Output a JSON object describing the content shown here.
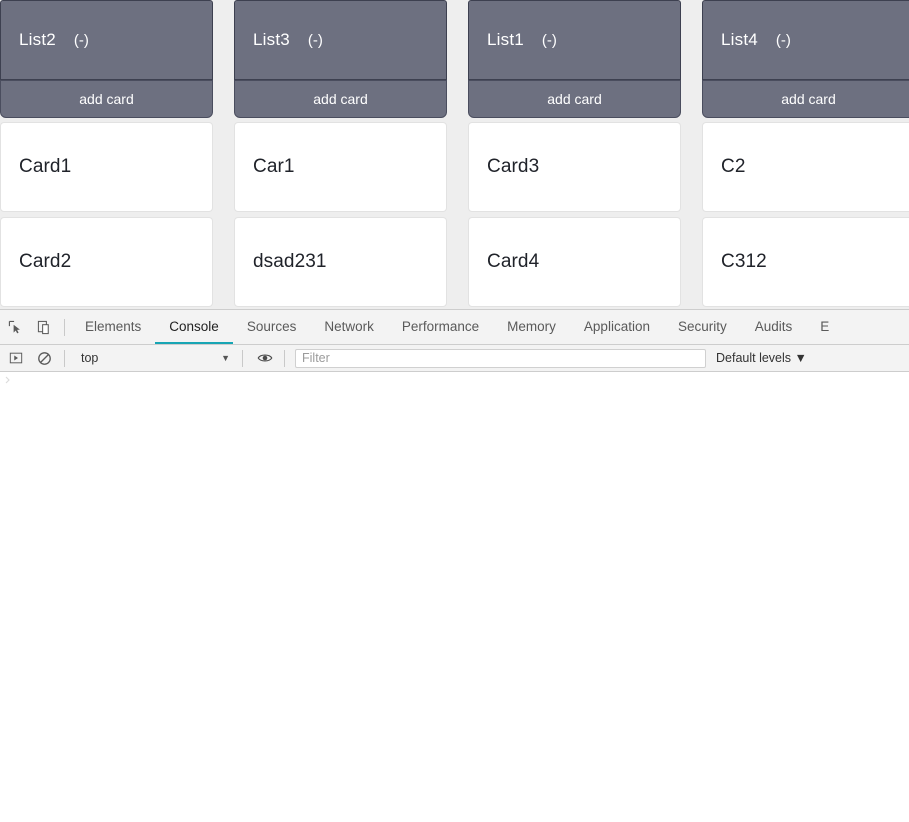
{
  "board": {
    "background_color": "#eeeeee",
    "list_header_color": "#6d7080",
    "lists": [
      {
        "title": "List2",
        "collapse_label": "(-)",
        "add_card_label": "add card",
        "cards": [
          {
            "text": "Card1"
          },
          {
            "text": "Card2"
          }
        ]
      },
      {
        "title": "List3",
        "collapse_label": "(-)",
        "add_card_label": "add card",
        "cards": [
          {
            "text": "Car1"
          },
          {
            "text": "dsad231"
          }
        ]
      },
      {
        "title": "List1",
        "collapse_label": "(-)",
        "add_card_label": "add card",
        "cards": [
          {
            "text": "Card3"
          },
          {
            "text": "Card4"
          }
        ]
      },
      {
        "title": "List4",
        "collapse_label": "(-)",
        "add_card_label": "add card",
        "cards": [
          {
            "text": "C2"
          },
          {
            "text": "C312"
          }
        ]
      }
    ]
  },
  "devtools": {
    "accent_color": "#17a5b4",
    "toolbar_icons": [
      {
        "name": "inspect-element-icon"
      },
      {
        "name": "device-toolbar-icon"
      }
    ],
    "tabs": [
      {
        "label": "Elements",
        "active": false
      },
      {
        "label": "Console",
        "active": true
      },
      {
        "label": "Sources",
        "active": false
      },
      {
        "label": "Network",
        "active": false
      },
      {
        "label": "Performance",
        "active": false
      },
      {
        "label": "Memory",
        "active": false
      },
      {
        "label": "Application",
        "active": false
      },
      {
        "label": "Security",
        "active": false
      },
      {
        "label": "Audits",
        "active": false
      },
      {
        "label": "E",
        "active": false
      }
    ],
    "console_toolbar": {
      "execute_icon": "execute-arrow-icon",
      "clear_icon": "clear-console-icon",
      "context_value": "top",
      "context_caret": "▼",
      "eye_icon": "live-expression-eye-icon",
      "filter_placeholder": "Filter",
      "filter_value": "",
      "levels_label": "Default levels",
      "levels_caret": "▼"
    }
  }
}
